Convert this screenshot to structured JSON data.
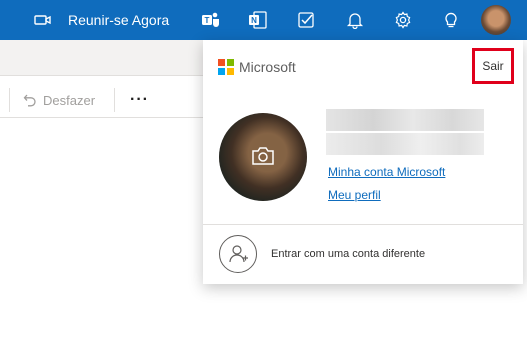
{
  "topbar": {
    "meet_label": "Reunir-se Agora",
    "accent": "#0f6cbd",
    "icons": [
      "video-camera-icon",
      "teams-icon",
      "onenote-icon",
      "todo-icon",
      "bell-icon",
      "gear-icon",
      "lightbulb-icon"
    ]
  },
  "toolbar": {
    "undo_label": "Desfazer",
    "more_label": "···"
  },
  "account_panel": {
    "brand": "Microsoft",
    "signout_label": "Sair",
    "signout_highlight": "#e0001b",
    "links": {
      "my_account": "Minha conta Microsoft",
      "my_profile": "Meu perfil"
    },
    "other_account_label": "Entrar com uma conta diferente"
  }
}
